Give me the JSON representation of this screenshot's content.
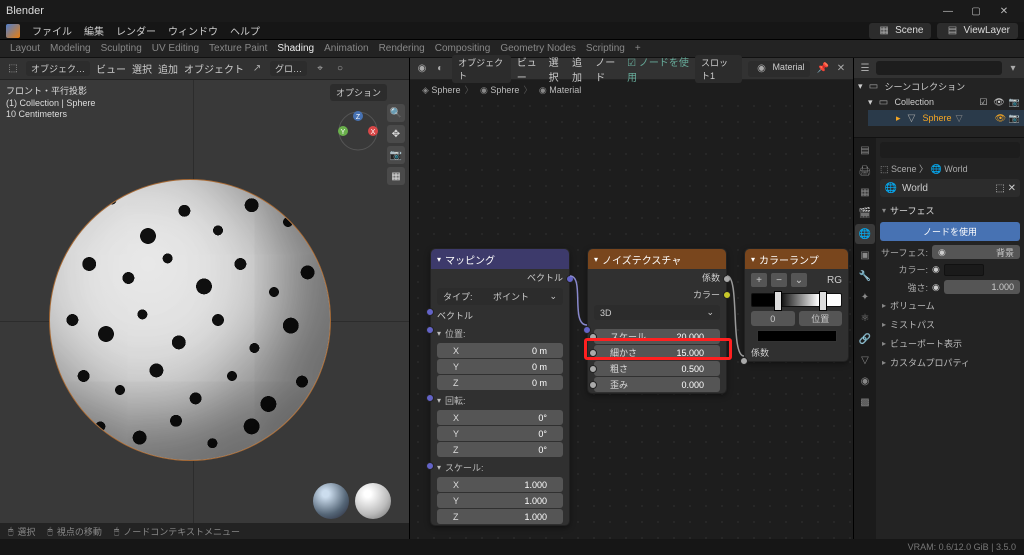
{
  "app_title": "Blender",
  "top_menu": [
    "ファイル",
    "編集",
    "レンダー",
    "ウィンドウ",
    "ヘルプ"
  ],
  "workspaces": [
    "Layout",
    "Modeling",
    "Sculpting",
    "UV Editing",
    "Texture Paint",
    "Shading",
    "Animation",
    "Rendering",
    "Compositing",
    "Geometry Nodes",
    "Scripting",
    "+"
  ],
  "active_workspace": "Shading",
  "scene_pill": "Scene",
  "viewlayer_pill": "ViewLayer",
  "viewport": {
    "header": {
      "view": "ビュー",
      "select": "選択",
      "add": "追加",
      "object": "オブジェクト",
      "mode": "オブジェク…",
      "global": "グロ…"
    },
    "overlay_text": "フロント・平行投影\n(1) Collection | Sphere\n10 Centimeters",
    "options_label": "オプション",
    "footer": {
      "select": "選択",
      "move": "視点の移動",
      "menu": "ノードコンテキストメニュー"
    }
  },
  "node_editor": {
    "header": {
      "view": "ビュー",
      "select": "選択",
      "add": "追加",
      "node": "ノード",
      "use_nodes": "ノードを使用",
      "object_mode": "オブジェクト",
      "slot": "スロット1",
      "material": "Material"
    },
    "breadcrumb": [
      "Sphere",
      "Sphere",
      "Material"
    ],
    "mapping": {
      "title": "マッピング",
      "out": "ベクトル",
      "type_label": "タイプ:",
      "type_value": "ポイント",
      "in": "ベクトル",
      "groups": {
        "pos": "位置:",
        "rot": "回転:",
        "scale": "スケール:"
      },
      "pos": [
        [
          "X",
          "0 m"
        ],
        [
          "Y",
          "0 m"
        ],
        [
          "Z",
          "0 m"
        ]
      ],
      "rot": [
        [
          "X",
          "0°"
        ],
        [
          "Y",
          "0°"
        ],
        [
          "Z",
          "0°"
        ]
      ],
      "scale": [
        [
          "X",
          "1.000"
        ],
        [
          "Y",
          "1.000"
        ],
        [
          "Z",
          "1.000"
        ]
      ]
    },
    "noise": {
      "title": "ノイズテクスチャ",
      "out_fac": "係数",
      "out_color": "カラー",
      "dim": "3D",
      "scale": [
        "スケール",
        "20.000"
      ],
      "detail": [
        "細かさ",
        "15.000"
      ],
      "rough": [
        "粗さ",
        "0.500"
      ],
      "distort": [
        "歪み",
        "0.000"
      ]
    },
    "ramp": {
      "title": "カラーランプ",
      "rg": "RG",
      "pos_value": "0",
      "pos_label": "位置",
      "out": "係数"
    }
  },
  "outliner": {
    "title": "シーンコレクション",
    "collection": "Collection",
    "sphere": "Sphere"
  },
  "properties": {
    "bc_scene": "Scene",
    "bc_world": "World",
    "world": "World",
    "surface_panel": "サーフェス",
    "use_nodes": "ノードを使用",
    "surface_label": "サーフェス:",
    "surface_value": "背景",
    "color_label": "カラー:",
    "strength_label": "強さ:",
    "strength_value": "1.000",
    "collapsed": [
      "ボリューム",
      "ミストパス",
      "ビューポート表示",
      "カスタムプロパティ"
    ]
  },
  "statusbar": {
    "vram": "VRAM: 0.6/12.0 GiB | 3.5.0"
  }
}
